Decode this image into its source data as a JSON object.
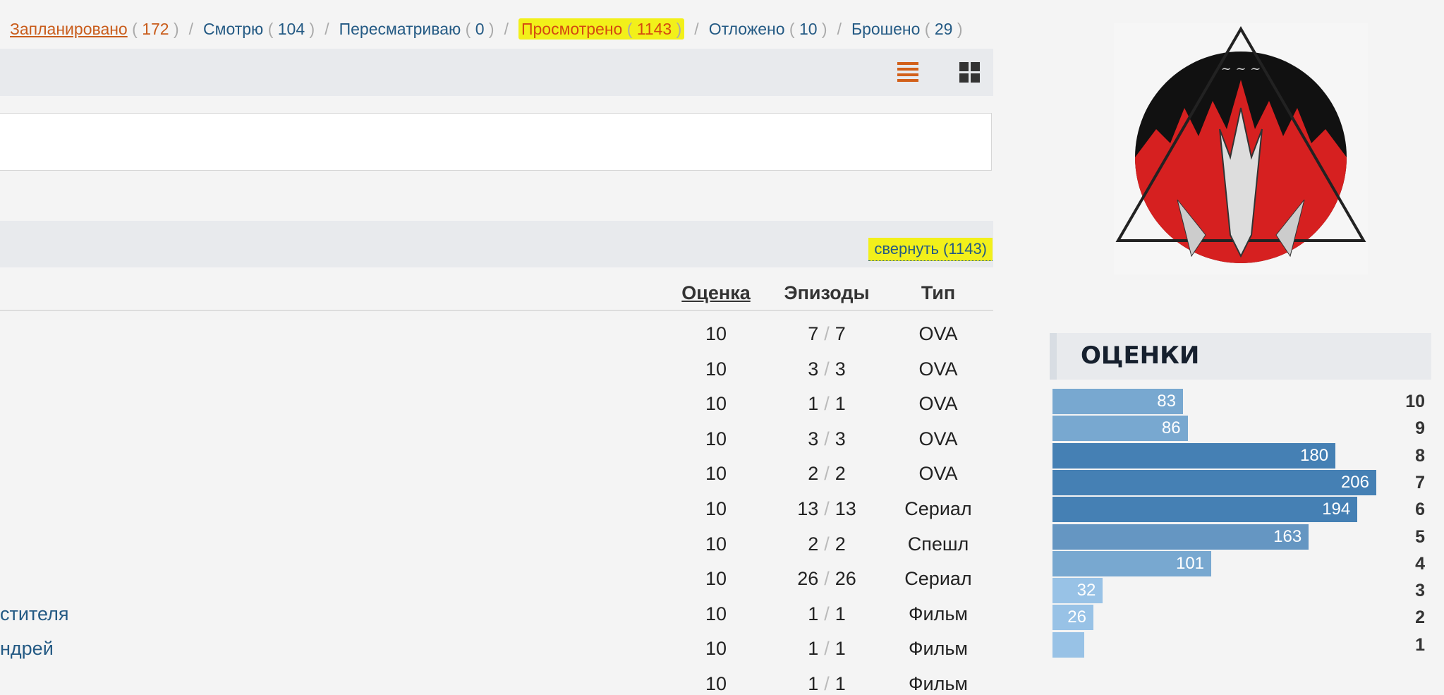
{
  "tabs": [
    {
      "label": "Запланировано",
      "count": "172",
      "state": "planned"
    },
    {
      "label": "Смотрю",
      "count": "104",
      "state": "normal"
    },
    {
      "label": "Пересматриваю",
      "count": "0",
      "state": "normal"
    },
    {
      "label": "Просмотрено",
      "count": "1143",
      "state": "active"
    },
    {
      "label": "Отложено",
      "count": "10",
      "state": "normal"
    },
    {
      "label": "Брошено",
      "count": "29",
      "state": "normal"
    }
  ],
  "toolbar": {
    "list_view_icon": "list-icon",
    "grid_view_icon": "grid-icon"
  },
  "collapse_label": "свернуть (1143)",
  "table": {
    "headers": {
      "score": "Оценка",
      "episodes": "Эпизоды",
      "type": "Тип"
    },
    "rows": [
      {
        "title": "",
        "score": "10",
        "watched": "7",
        "total": "7",
        "type": "OVA"
      },
      {
        "title": "",
        "score": "10",
        "watched": "3",
        "total": "3",
        "type": "OVA"
      },
      {
        "title": "",
        "score": "10",
        "watched": "1",
        "total": "1",
        "type": "OVA"
      },
      {
        "title": "",
        "score": "10",
        "watched": "3",
        "total": "3",
        "type": "OVA"
      },
      {
        "title": "",
        "score": "10",
        "watched": "2",
        "total": "2",
        "type": "OVA"
      },
      {
        "title": "",
        "score": "10",
        "watched": "13",
        "total": "13",
        "type": "Сериал"
      },
      {
        "title": "",
        "score": "10",
        "watched": "2",
        "total": "2",
        "type": "Спешл"
      },
      {
        "title": "",
        "score": "10",
        "watched": "26",
        "total": "26",
        "type": "Сериал"
      },
      {
        "title": "стителя",
        "score": "10",
        "watched": "1",
        "total": "1",
        "type": "Фильм"
      },
      {
        "title": "ндрей",
        "score": "10",
        "watched": "1",
        "total": "1",
        "type": "Фильм"
      },
      {
        "title": "",
        "score": "10",
        "watched": "1",
        "total": "1",
        "type": "Фильм"
      }
    ]
  },
  "ratings": {
    "title": "ОЦЕНКИ",
    "items": [
      {
        "score": "10",
        "count": 83,
        "label": "83"
      },
      {
        "score": "9",
        "count": 86,
        "label": "86"
      },
      {
        "score": "8",
        "count": 180,
        "label": "180"
      },
      {
        "score": "7",
        "count": 206,
        "label": "206"
      },
      {
        "score": "6",
        "count": 194,
        "label": "194"
      },
      {
        "score": "5",
        "count": 163,
        "label": "163"
      },
      {
        "score": "4",
        "count": 101,
        "label": "101"
      },
      {
        "score": "3",
        "count": 32,
        "label": "32"
      },
      {
        "score": "2",
        "count": 26,
        "label": "26"
      },
      {
        "score": "1",
        "count": 20,
        "label": ""
      }
    ],
    "colors": {
      "dark": "#4580b4",
      "mid": "#6596c2",
      "light": "#78a8d0",
      "lightest": "#98c2e6"
    }
  }
}
